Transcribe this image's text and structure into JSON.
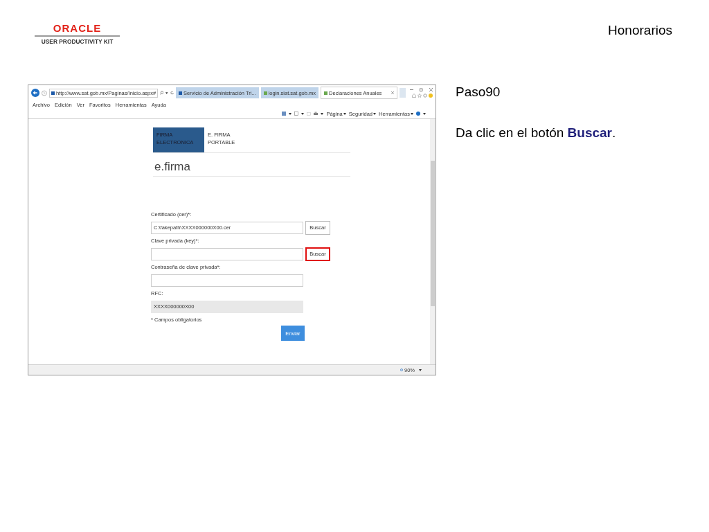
{
  "header": {
    "logo_text": "ORACLE",
    "logo_subtitle": "USER PRODUCTIVITY KIT",
    "title": "Honorarios"
  },
  "browser": {
    "address": "http://www.sat.gob.mx/Paginas/Inicio.aspx#",
    "tabs": [
      {
        "label": "Servicio de Administración Tri...",
        "selected": false
      },
      {
        "label": "login.siat.sat.gob.mx",
        "selected": false
      },
      {
        "label": "Declaraciones Anuales",
        "selected": true
      }
    ],
    "menu": [
      "Archivo",
      "Edición",
      "Ver",
      "Favoritos",
      "Herramientas",
      "Ayuda"
    ],
    "command_bar": [
      "Página",
      "Seguridad",
      "Herramientas"
    ],
    "zoom": "90%"
  },
  "page": {
    "portal_tabs": [
      {
        "label": "FIRMA ELECTRONICA",
        "selected": true
      },
      {
        "label": "E. FIRMA PORTABLE",
        "selected": false
      }
    ],
    "heading": "e.firma",
    "fields": [
      {
        "label": "Certificado (cer)*:",
        "value": "C:\\fakepath\\XXXX000000X00.cer",
        "button": "Buscar",
        "highlighted": false,
        "disabled": false
      },
      {
        "label": "Clave privada (key)*:",
        "button": "Buscar",
        "highlighted": true,
        "disabled": false
      },
      {
        "label": "Contraseña de clave privada*:",
        "disabled": false
      },
      {
        "label": "RFC:",
        "value": "XXXX000000X00",
        "disabled": true
      }
    ],
    "note": "* Campos obligatorios",
    "submit": "Enviar"
  },
  "step": {
    "title": "Paso90",
    "instruction": "Da clic en el botón **Buscar**."
  }
}
